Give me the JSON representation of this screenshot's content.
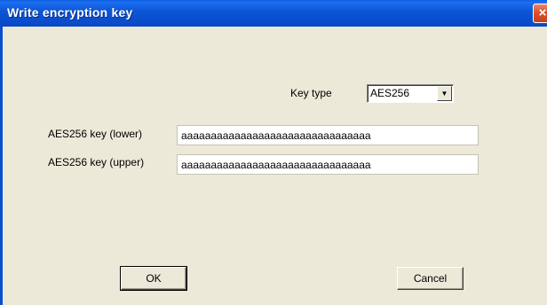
{
  "window": {
    "title": "Write encryption key",
    "close_glyph": "×"
  },
  "form": {
    "key_type_label": "Key type",
    "key_type_value": "AES256",
    "dropdown_arrow_glyph": "▼",
    "lower_label": "AES256 key (lower)",
    "lower_value": "aaaaaaaaaaaaaaaaaaaaaaaaaaaaaaaa",
    "upper_label": "AES256 key (upper)",
    "upper_value": "aaaaaaaaaaaaaaaaaaaaaaaaaaaaaaaa"
  },
  "buttons": {
    "ok_label": "OK",
    "cancel_label": "Cancel"
  },
  "colors": {
    "titlebar": "#0a4fd0",
    "dialog_bg": "#ece9d8",
    "close_button": "#d9512c"
  }
}
